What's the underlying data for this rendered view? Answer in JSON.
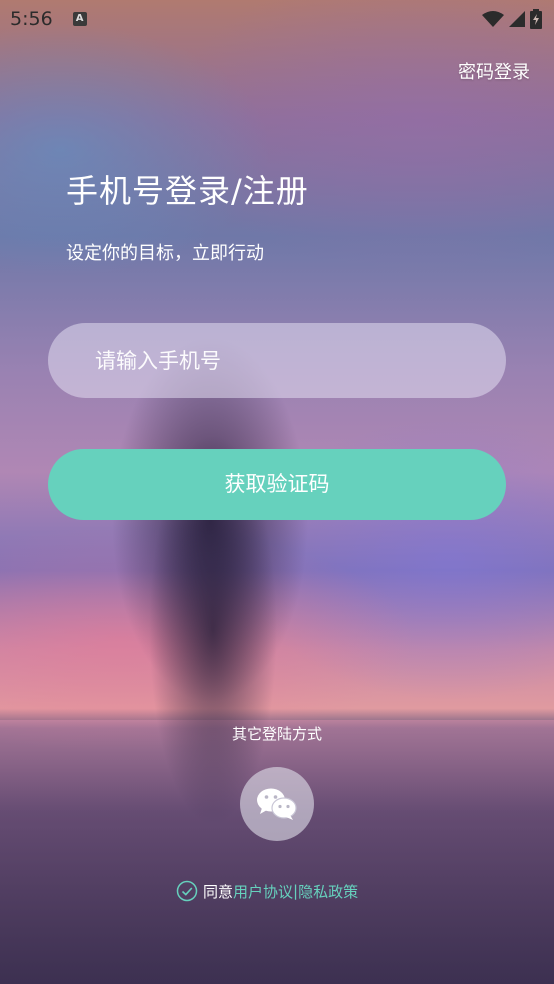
{
  "status_bar": {
    "time": "5:56",
    "notification_icon": "a-icon",
    "icons": [
      "wifi-icon",
      "signal-icon",
      "battery-charging-icon"
    ]
  },
  "header": {
    "password_login": "密码登录"
  },
  "main": {
    "title": "手机号登录/注册",
    "subtitle": "设定你的目标，立即行动",
    "phone_placeholder": "请输入手机号",
    "get_code_label": "获取验证码"
  },
  "footer": {
    "other_methods": "其它登陆方式",
    "wechat_icon": "wechat-icon",
    "agree_prefix": "同意",
    "user_agreement": "用户协议",
    "separator": "|",
    "privacy_policy": "隐私政策"
  },
  "colors": {
    "accent": "#66d1bd",
    "text": "#ffffff"
  }
}
